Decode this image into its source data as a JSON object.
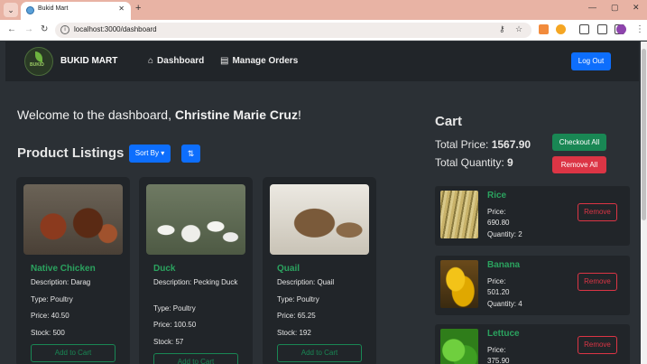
{
  "browser": {
    "tab_title": "Bukid Mart",
    "tab_close": "✕",
    "new_tab": "+",
    "url": "localhost:3000/dashboard",
    "window_controls": [
      "—",
      "▢",
      "✕"
    ]
  },
  "navbar": {
    "logo_text": "BUKID",
    "brand": "BUKID MART",
    "links": [
      {
        "label": "Dashboard",
        "icon": "home-icon"
      },
      {
        "label": "Manage Orders",
        "icon": "list-icon"
      }
    ],
    "logout_label": "Log Out"
  },
  "welcome": {
    "prefix": "Welcome to the dashboard, ",
    "name": "Christine Marie Cruz",
    "suffix": "!"
  },
  "listings": {
    "title": "Product Listings",
    "sort_label": "Sort By",
    "swap_icon": "sort-icon",
    "products": [
      {
        "name": "Native Chicken",
        "description": "Description: Darag",
        "type": "Type: Poultry",
        "price": "Price: 40.50",
        "stock": "Stock: 500",
        "button": "Add to Cart"
      },
      {
        "name": "Duck",
        "description": "Description: Pecking Duck",
        "type": "Type: Poultry",
        "price": "Price: 100.50",
        "stock": "Stock: 57",
        "button": "Add to Cart"
      },
      {
        "name": "Quail",
        "description": "Description: Quail",
        "type": "Type: Poultry",
        "price": "Price: 65.25",
        "stock": "Stock: 192",
        "button": "Add to Cart"
      }
    ]
  },
  "cart": {
    "title": "Cart",
    "total_price_label": "Total Price: ",
    "total_price": "1567.90",
    "total_quantity_label": "Total Quantity: ",
    "total_quantity": "9",
    "checkout_label": "Checkout All",
    "remove_all_label": "Remove All",
    "items": [
      {
        "name": "Rice",
        "price_label": "Price:",
        "price": "690.80",
        "quantity": "Quantity: 2",
        "remove": "Remove"
      },
      {
        "name": "Banana",
        "price_label": "Price:",
        "price": "501.20",
        "quantity": "Quantity: 4",
        "remove": "Remove"
      },
      {
        "name": "Lettuce",
        "price_label": "Price:",
        "price": "375.90",
        "quantity": "",
        "remove": "Remove"
      }
    ]
  },
  "colors": {
    "background": "#2b3035",
    "card": "#212529",
    "accent_blue": "#0d6efd",
    "accent_green": "#198754",
    "product_name_green": "#2ba35f",
    "danger": "#dc3545"
  }
}
